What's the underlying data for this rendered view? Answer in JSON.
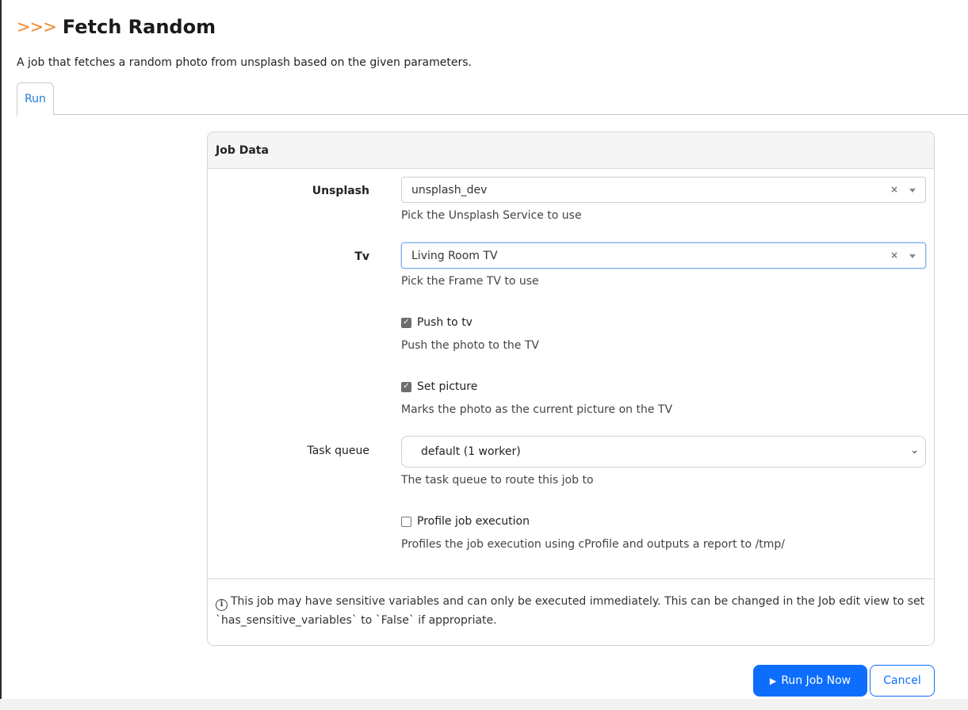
{
  "page": {
    "chevrons": ">>>",
    "title": "Fetch Random",
    "description": "A job that fetches a random photo from unsplash based on the given parameters."
  },
  "tabs": [
    {
      "label": "Run",
      "active": true
    }
  ],
  "panel": {
    "heading": "Job Data",
    "unsplash": {
      "label": "Unsplash",
      "value": "unsplash_dev",
      "help": "Pick the Unsplash Service to use"
    },
    "tv": {
      "label": "Tv",
      "value": "Living Room TV",
      "help": "Pick the Frame TV to use"
    },
    "push_to_tv": {
      "label": "Push to tv",
      "checked": true,
      "help": "Push the photo to the TV"
    },
    "set_picture": {
      "label": "Set picture",
      "checked": true,
      "help": "Marks the photo as the current picture on the TV"
    },
    "task_queue": {
      "label": "Task queue",
      "value": "default (1 worker)",
      "help": "The task queue to route this job to"
    },
    "profile": {
      "label": "Profile job execution",
      "checked": false,
      "help": "Profiles the job execution using cProfile and outputs a report to /tmp/"
    },
    "footer_line1": "This job may have sensitive variables and can only be executed immediately. This can be changed in the Job edit view to set",
    "footer_line2": "`has_sensitive_variables` to `False` if appropriate."
  },
  "buttons": {
    "run": "Run Job Now",
    "cancel": "Cancel"
  },
  "colors": {
    "accent": "#0d6efd",
    "chevron": "#f0882e",
    "tab_text": "#1d7dd8"
  }
}
